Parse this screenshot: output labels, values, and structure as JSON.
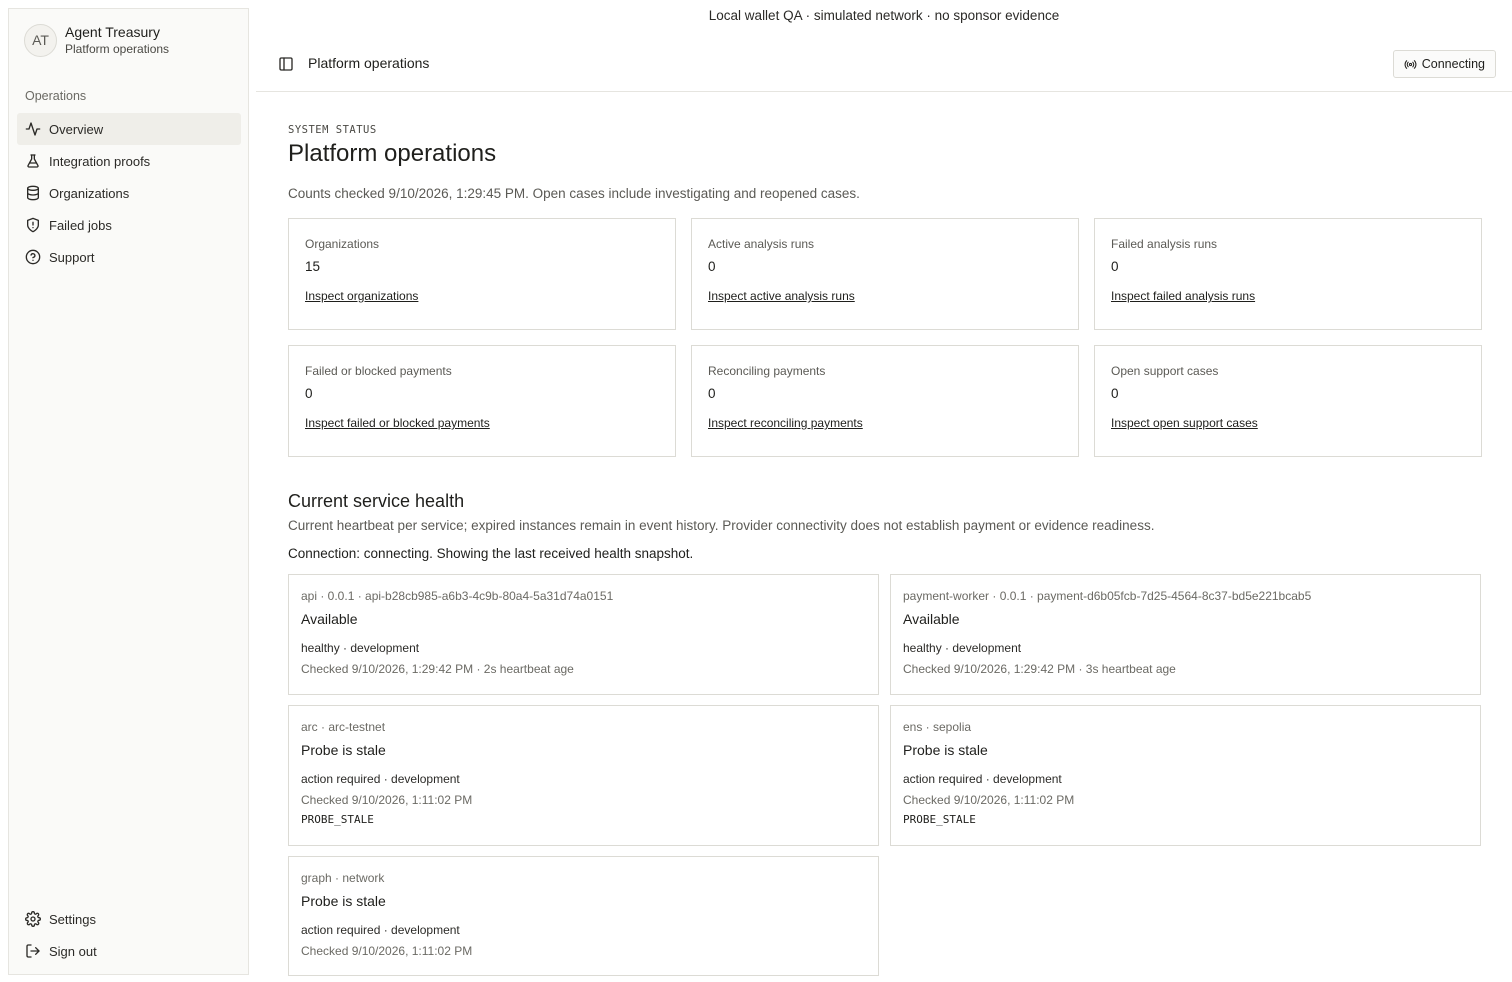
{
  "brand": {
    "initials": "AT",
    "name": "Agent Treasury",
    "subtitle": "Platform operations"
  },
  "sidebar": {
    "group_label": "Operations",
    "items": [
      {
        "label": "Overview",
        "icon": "activity-icon",
        "active": true
      },
      {
        "label": "Integration proofs",
        "icon": "flask-icon"
      },
      {
        "label": "Organizations",
        "icon": "database-icon"
      },
      {
        "label": "Failed jobs",
        "icon": "shield-alert-icon"
      },
      {
        "label": "Support",
        "icon": "help-circle-icon"
      }
    ],
    "bottom": [
      {
        "label": "Settings",
        "icon": "gear-icon"
      },
      {
        "label": "Sign out",
        "icon": "sign-out-icon"
      }
    ]
  },
  "banner": "Local wallet QA · simulated network · no sponsor evidence",
  "header": {
    "title": "Platform operations",
    "connection_button": "Connecting"
  },
  "main": {
    "eyebrow": "SYSTEM STATUS",
    "title": "Platform operations",
    "counts_note": "Counts checked 9/10/2026, 1:29:45 PM. Open cases include investigating and reopened cases.",
    "metrics": [
      {
        "label": "Organizations",
        "value": "15",
        "link": "Inspect organizations"
      },
      {
        "label": "Active analysis runs",
        "value": "0",
        "link": "Inspect active analysis runs"
      },
      {
        "label": "Failed analysis runs",
        "value": "0",
        "link": "Inspect failed analysis runs"
      },
      {
        "label": "Failed or blocked payments",
        "value": "0",
        "link": "Inspect failed or blocked payments"
      },
      {
        "label": "Reconciling payments",
        "value": "0",
        "link": "Inspect reconciling payments"
      },
      {
        "label": "Open support cases",
        "value": "0",
        "link": "Inspect open support cases"
      }
    ],
    "health": {
      "title": "Current service health",
      "description": "Current heartbeat per service; expired instances remain in event history. Provider connectivity does not establish payment or evidence readiness.",
      "connection": "Connection: connecting. Showing the last received health snapshot.",
      "cards": [
        {
          "meta": "api · 0.0.1 · api-b28cb985-a6b3-4c9b-80a4-5a31d74a0151",
          "status": "Available",
          "line": "healthy · development",
          "checked": "Checked 9/10/2026, 1:29:42 PM · 2s heartbeat age",
          "code": ""
        },
        {
          "meta": "payment-worker · 0.0.1 · payment-d6b05fcb-7d25-4564-8c37-bd5e221bcab5",
          "status": "Available",
          "line": "healthy · development",
          "checked": "Checked 9/10/2026, 1:29:42 PM · 3s heartbeat age",
          "code": ""
        },
        {
          "meta": "arc · arc-testnet",
          "status": "Probe is stale",
          "line": "action required · development",
          "checked": "Checked 9/10/2026, 1:11:02 PM",
          "code": "PROBE_STALE"
        },
        {
          "meta": "ens · sepolia",
          "status": "Probe is stale",
          "line": "action required · development",
          "checked": "Checked 9/10/2026, 1:11:02 PM",
          "code": "PROBE_STALE"
        },
        {
          "meta": "graph · network",
          "status": "Probe is stale",
          "line": "action required · development",
          "checked": "Checked 9/10/2026, 1:11:02 PM",
          "code": ""
        }
      ]
    }
  }
}
